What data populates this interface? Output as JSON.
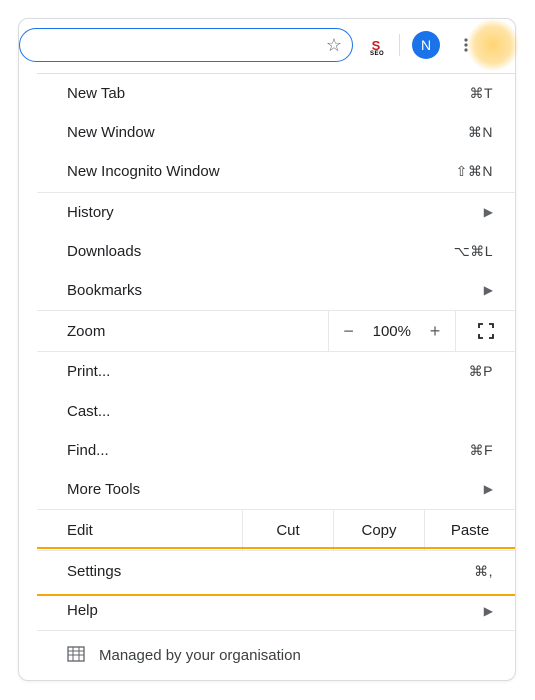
{
  "toolbar": {
    "avatar_letter": "N",
    "ext_letter": "S",
    "ext_sub": "SEO"
  },
  "menu": {
    "new_tab": {
      "label": "New Tab",
      "shortcut": "⌘T"
    },
    "new_window": {
      "label": "New Window",
      "shortcut": "⌘N"
    },
    "new_incognito": {
      "label": "New Incognito Window",
      "shortcut": "⇧⌘N"
    },
    "history": {
      "label": "History"
    },
    "downloads": {
      "label": "Downloads",
      "shortcut": "⌥⌘L"
    },
    "bookmarks": {
      "label": "Bookmarks"
    },
    "zoom": {
      "label": "Zoom",
      "minus": "−",
      "value": "100%",
      "plus": "+"
    },
    "print": {
      "label": "Print...",
      "shortcut": "⌘P"
    },
    "cast": {
      "label": "Cast..."
    },
    "find": {
      "label": "Find...",
      "shortcut": "⌘F"
    },
    "more_tools": {
      "label": "More Tools"
    },
    "edit": {
      "label": "Edit",
      "cut": "Cut",
      "copy": "Copy",
      "paste": "Paste"
    },
    "settings": {
      "label": "Settings",
      "shortcut": "⌘,"
    },
    "help": {
      "label": "Help"
    },
    "managed": {
      "label": "Managed by your organisation"
    }
  }
}
